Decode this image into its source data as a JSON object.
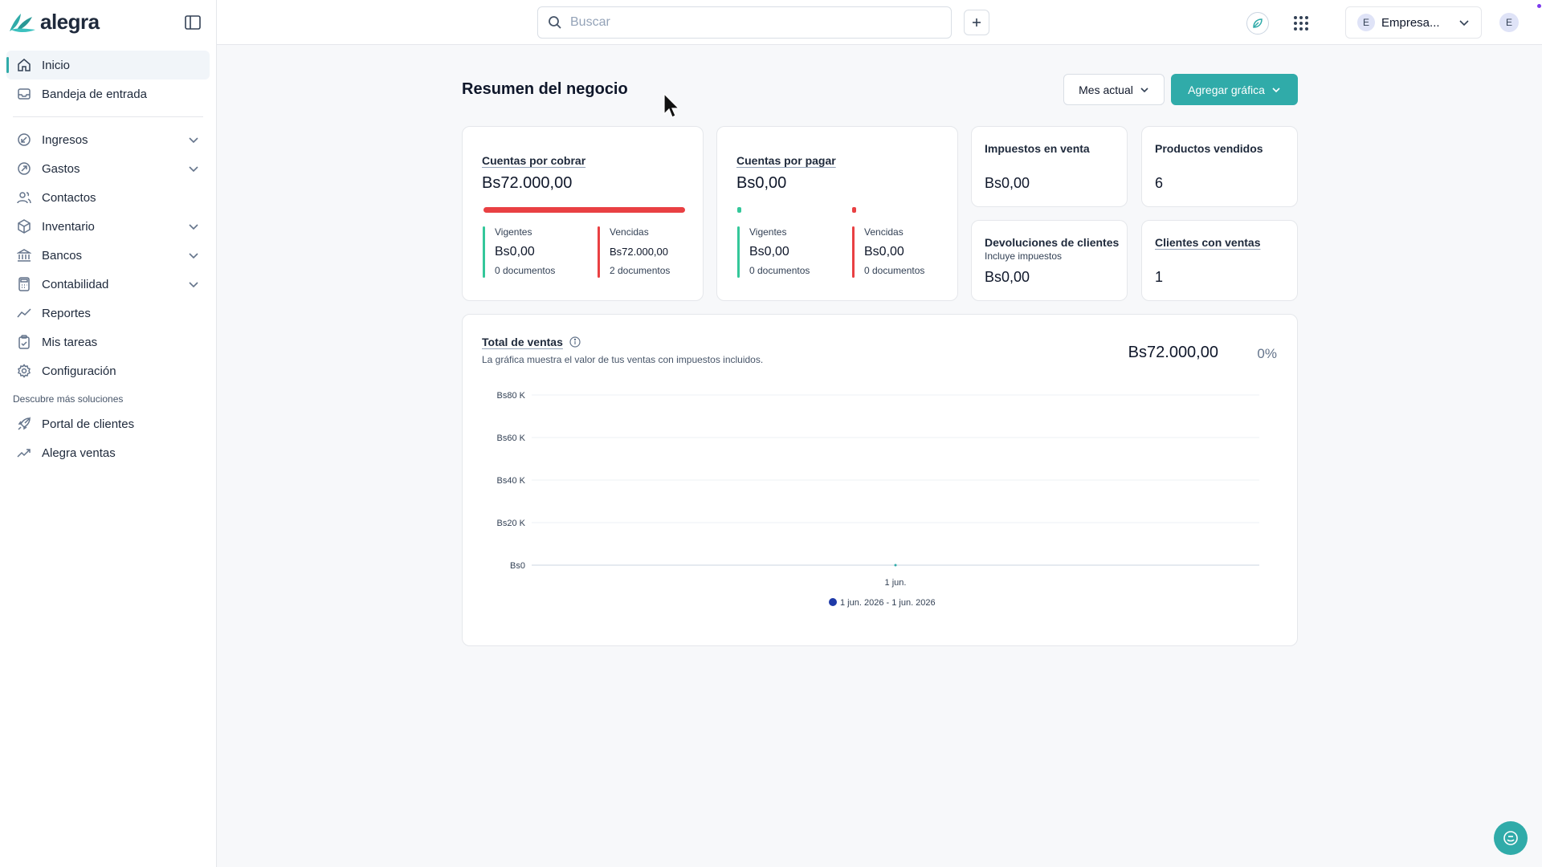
{
  "app": {
    "logo_text": "alegra"
  },
  "sidebar": {
    "items": [
      {
        "label": "Inicio"
      },
      {
        "label": "Bandeja de entrada"
      },
      {
        "label": "Ingresos"
      },
      {
        "label": "Gastos"
      },
      {
        "label": "Contactos"
      },
      {
        "label": "Inventario"
      },
      {
        "label": "Bancos"
      },
      {
        "label": "Contabilidad"
      },
      {
        "label": "Reportes"
      },
      {
        "label": "Mis tareas"
      },
      {
        "label": "Configuración"
      }
    ],
    "section_title": "Descubre más soluciones",
    "extra_items": [
      {
        "label": "Portal de clientes"
      },
      {
        "label": "Alegra ventas"
      }
    ]
  },
  "topbar": {
    "search_placeholder": "Buscar",
    "company_initial": "E",
    "company_name": "Empresa...",
    "user_initial": "E"
  },
  "main": {
    "title": "Resumen del negocio",
    "period_button": "Mes actual",
    "add_chart_button": "Agregar gráfica"
  },
  "receivable": {
    "title": "Cuentas por cobrar",
    "amount": "Bs72.000,00",
    "current_label": "Vigentes",
    "current_amount": "Bs0,00",
    "current_docs": "0 documentos",
    "overdue_label": "Vencidas",
    "overdue_amount": "Bs72.000,00",
    "overdue_docs": "2 documentos"
  },
  "payable": {
    "title": "Cuentas por pagar",
    "amount": "Bs0,00",
    "current_label": "Vigentes",
    "current_amount": "Bs0,00",
    "current_docs": "0 documentos",
    "overdue_label": "Vencidas",
    "overdue_amount": "Bs0,00",
    "overdue_docs": "0 documentos"
  },
  "taxes": {
    "title": "Impuestos en venta",
    "value": "Bs0,00"
  },
  "products": {
    "title": "Productos vendidos",
    "value": "6"
  },
  "returns": {
    "title": "Devoluciones de clientes",
    "subtitle": "Incluye impuestos",
    "value": "Bs0,00"
  },
  "clients": {
    "title": "Clientes con ventas",
    "value": "1"
  },
  "sales": {
    "title": "Total de ventas",
    "description": "La gráfica muestra el valor de tus ventas con impuestos incluidos.",
    "total": "Bs72.000,00",
    "change": "0%"
  },
  "colors": {
    "accent": "#30aba9",
    "overdue": "#e94043",
    "current": "#34c79a",
    "series": "#1e3aa8"
  },
  "chart_data": {
    "type": "line",
    "categories": [
      "1 jun."
    ],
    "series": [
      {
        "name": "1 jun. 2026 - 1 jun. 2026",
        "values": [
          0
        ]
      }
    ],
    "ytick_labels": [
      "Bs0",
      "Bs20 K",
      "Bs40 K",
      "Bs60 K",
      "Bs80 K"
    ],
    "yticks": [
      0,
      20000,
      40000,
      60000,
      80000
    ],
    "ylim": [
      0,
      80000
    ],
    "grid": true,
    "legend": "bottom"
  }
}
